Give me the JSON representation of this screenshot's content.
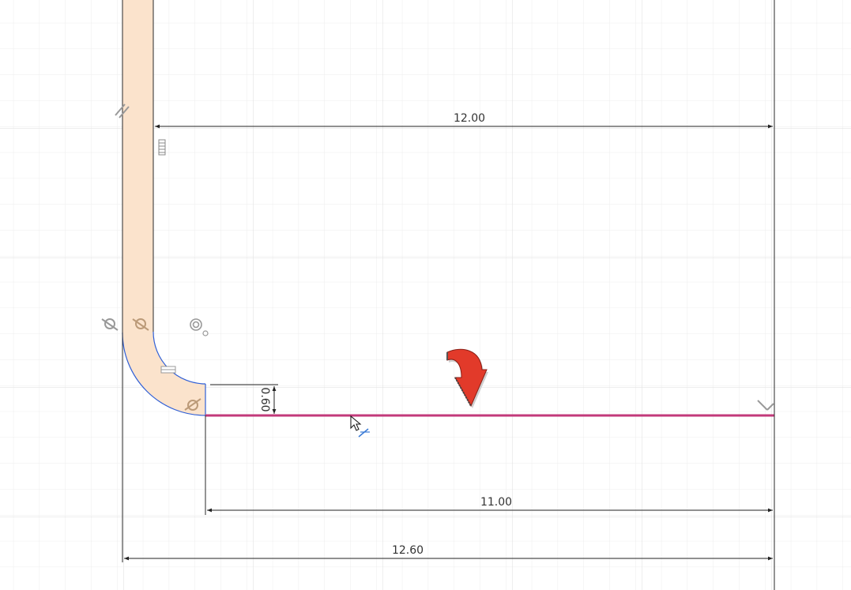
{
  "sketch": {
    "dimensions": {
      "top_length": "12.00",
      "middle_length": "11.00",
      "bottom_length": "12.60",
      "thickness": "0.60"
    },
    "icons": {
      "parallel": "parallel-constraint-icon",
      "fix": "fix-constraint-icon",
      "tangent_a": "tangent-constraint-icon",
      "tangent_b": "tangent-constraint-icon",
      "concentric": "concentric-constraint-icon",
      "horizontal": "horizontal-constraint-icon",
      "tangent_c": "tangent-constraint-icon",
      "perpendicular": "perpendicular-constraint-icon",
      "bend_arrow": "curved-arrow-icon",
      "cursor": "mouse-pointer-icon"
    },
    "colors": {
      "profile_fill": "#fbe3cc",
      "selected_line": "#c2397a",
      "arc": "#2f5fd6",
      "arrow": "#e23a2a",
      "grid_minor": "#ececec",
      "grid_major": "#dcdcdc"
    }
  }
}
